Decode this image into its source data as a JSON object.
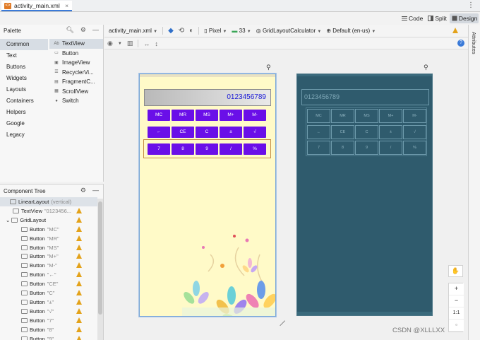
{
  "tab": {
    "title": "activity_main.xml",
    "close": "×"
  },
  "more": "⋮",
  "view_modes": [
    {
      "label": "Code"
    },
    {
      "label": "Split"
    },
    {
      "label": "Design"
    }
  ],
  "palette": {
    "title": "Palette",
    "categories": [
      "Common",
      "Text",
      "Buttons",
      "Widgets",
      "Layouts",
      "Containers",
      "Helpers",
      "Google",
      "Legacy"
    ],
    "widgets": [
      {
        "icon": "Ab",
        "label": "TextView"
      },
      {
        "icon": "▭",
        "label": "Button"
      },
      {
        "icon": "▣",
        "label": "ImageView"
      },
      {
        "icon": "☰",
        "label": "RecyclerVi..."
      },
      {
        "icon": "▤",
        "label": "FragmentC..."
      },
      {
        "icon": "▦",
        "label": "ScrollView"
      },
      {
        "icon": "●",
        "label": "Switch"
      }
    ]
  },
  "component_tree": {
    "title": "Component Tree",
    "rows": [
      {
        "name": "LinearLayout",
        "value": "(vertical)"
      },
      {
        "name": "TextView",
        "value": "\"0123456..."
      },
      {
        "name": "GridLayout",
        "value": ""
      },
      {
        "name": "Button",
        "value": "\"MC\""
      },
      {
        "name": "Button",
        "value": "\"MR\""
      },
      {
        "name": "Button",
        "value": "\"MS\""
      },
      {
        "name": "Button",
        "value": "\"M+\""
      },
      {
        "name": "Button",
        "value": "\"M-\""
      },
      {
        "name": "Button",
        "value": "\"←\""
      },
      {
        "name": "Button",
        "value": "\"CE\""
      },
      {
        "name": "Button",
        "value": "\"C\""
      },
      {
        "name": "Button",
        "value": "\"±\""
      },
      {
        "name": "Button",
        "value": "\"√\""
      },
      {
        "name": "Button",
        "value": "\"7\""
      },
      {
        "name": "Button",
        "value": "\"8\""
      },
      {
        "name": "Button",
        "value": "\"9\""
      }
    ]
  },
  "toolbar": {
    "file": "activity_main.xml",
    "device": "Pixel",
    "api": "33",
    "activity": "GridLayoutCalculator",
    "locale": "Default (en-us)"
  },
  "attributes_label": "Attributes",
  "calculator": {
    "display": "0123456789",
    "buttons": [
      "MC",
      "MR",
      "MS",
      "M+",
      "M-",
      "←",
      "CE",
      "C",
      "±",
      "√",
      "7",
      "8",
      "9",
      "/",
      "%"
    ]
  },
  "zoom": {
    "pan": "✋",
    "plus": "+",
    "minus": "−",
    "one_to_one": "1:1"
  },
  "watermark": "CSDN @XLLLXX"
}
